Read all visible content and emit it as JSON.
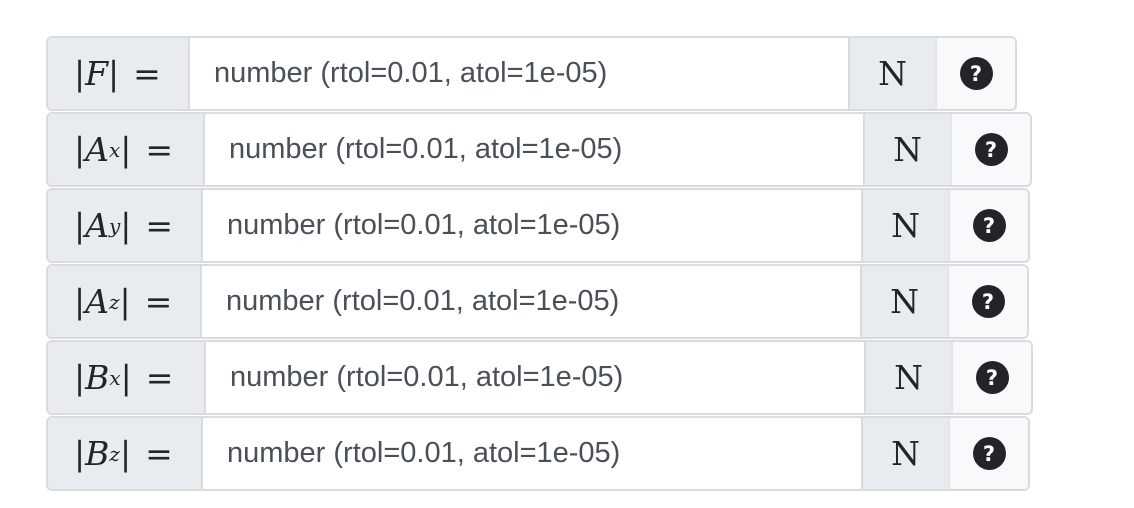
{
  "placeholder": "number (rtol=0.01, atol=1e-05)",
  "unit": "N",
  "help_glyph": "?",
  "rows": [
    {
      "symbol": "F",
      "subscript": "",
      "equals": "="
    },
    {
      "symbol": "A",
      "subscript": "x",
      "equals": "="
    },
    {
      "symbol": "A",
      "subscript": "y",
      "equals": "="
    },
    {
      "symbol": "A",
      "subscript": "z",
      "equals": "="
    },
    {
      "symbol": "B",
      "subscript": "x",
      "equals": "="
    },
    {
      "symbol": "B",
      "subscript": "z",
      "equals": "="
    }
  ],
  "colors": {
    "addon_background": "#e9ecef",
    "border": "#d9dcdf",
    "text": "#212529",
    "input_text": "#495057",
    "help_background": "#f8f9fa"
  }
}
